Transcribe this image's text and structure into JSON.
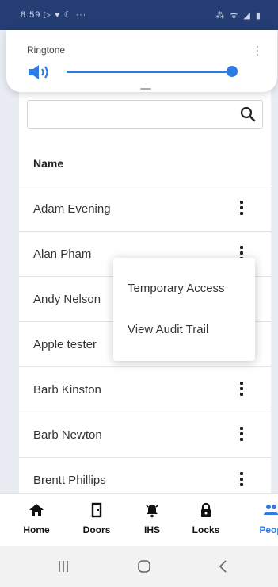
{
  "status_bar": {
    "left_text": "8:59 ▷ ♥ ☾  ···",
    "right_text": "⁂ ᯤ ◢ ▮"
  },
  "volume_panel": {
    "label": "Ringtone",
    "level": 0.95,
    "accent": "#2d7be6"
  },
  "search": {
    "placeholder": "",
    "value": ""
  },
  "table": {
    "header": "Name",
    "rows": [
      "Adam Evening",
      "Alan Pham",
      "Andy Nelson",
      "Apple tester",
      "Barb Kinston",
      "Barb Newton",
      "Brentt Phillips"
    ]
  },
  "context_menu": {
    "items": [
      "Temporary Access",
      "View Audit Trail"
    ]
  },
  "bottom_nav": {
    "items": [
      {
        "label": "Home",
        "icon": "home-icon"
      },
      {
        "label": "Doors",
        "icon": "door-icon"
      },
      {
        "label": "IHS",
        "icon": "bell-icon"
      },
      {
        "label": "Locks",
        "icon": "lock-icon"
      },
      {
        "label": "Peop",
        "icon": "people-icon",
        "active": true
      }
    ]
  },
  "system_nav": {
    "buttons": [
      "recents-icon",
      "home-circle-icon",
      "back-icon"
    ]
  }
}
